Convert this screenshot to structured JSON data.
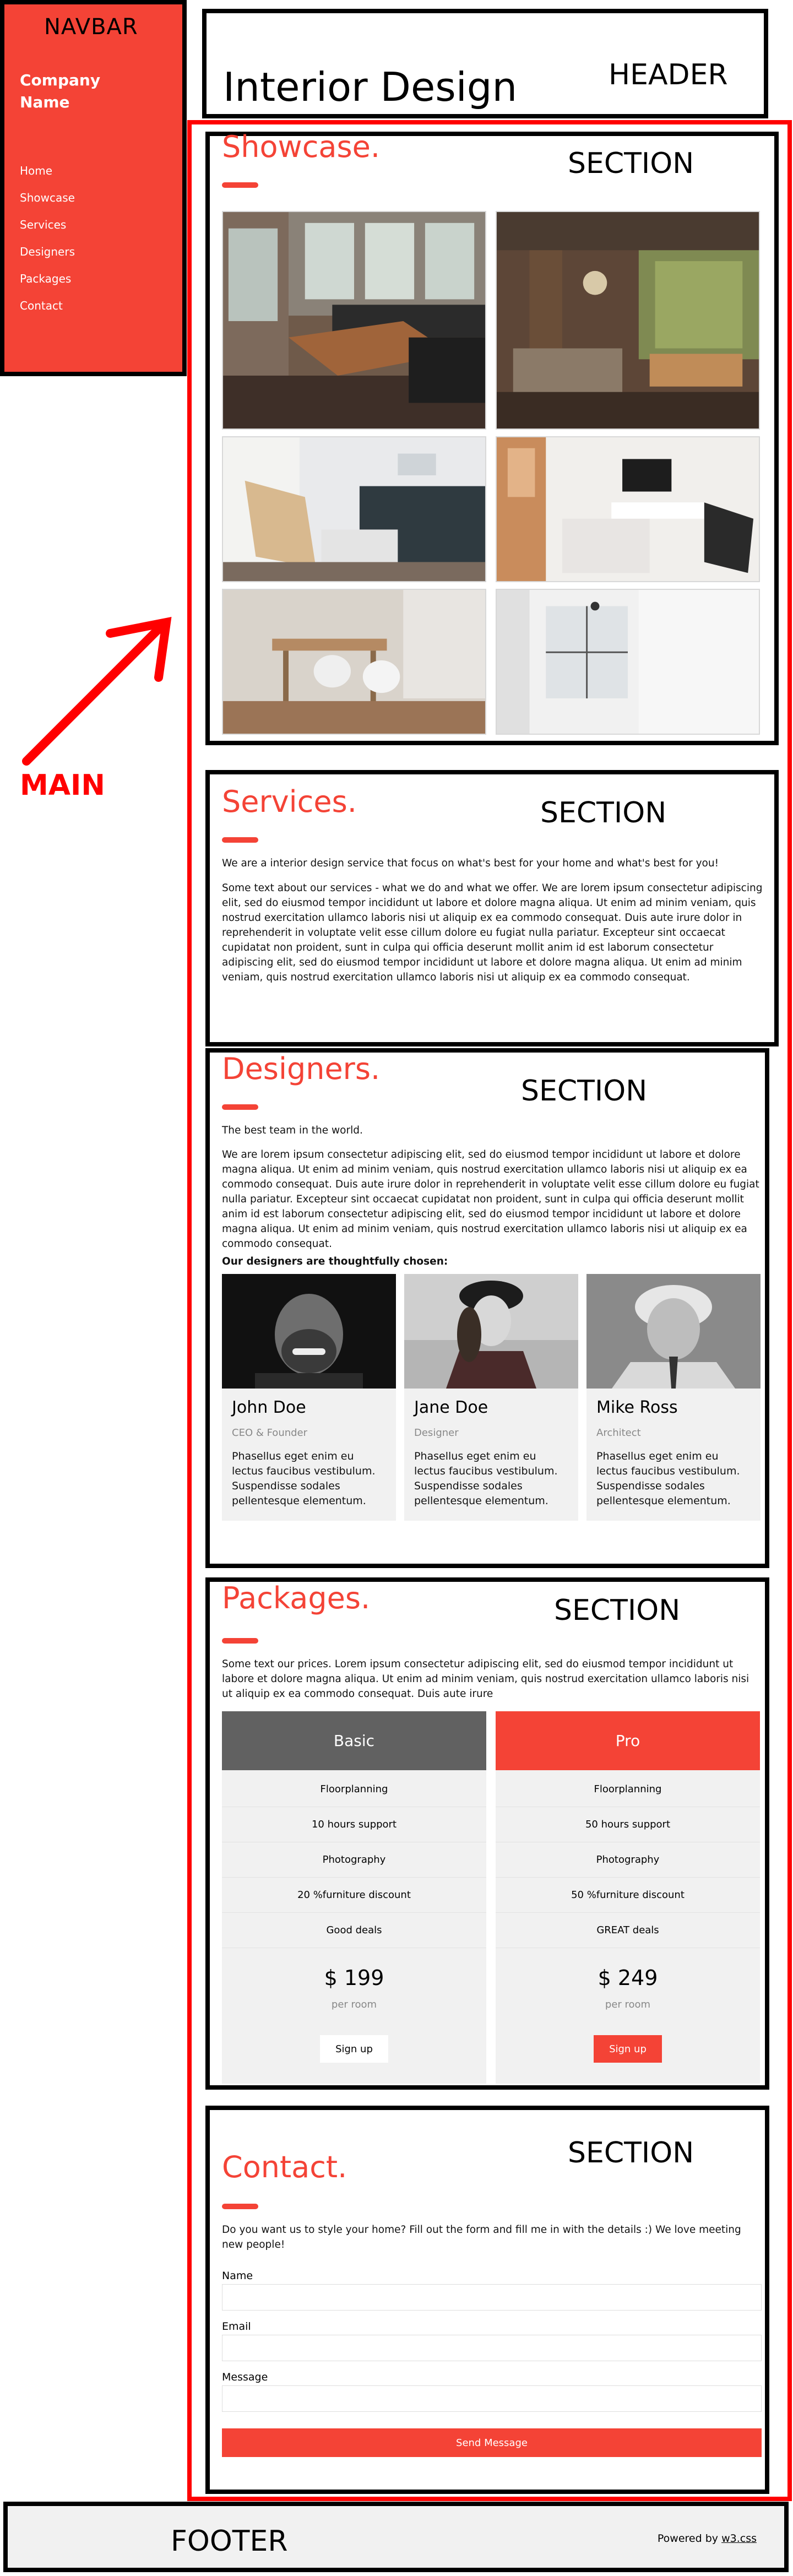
{
  "annotations": {
    "navbar": "NAVBAR",
    "header": "HEADER",
    "section": "SECTION",
    "main": "MAIN",
    "footer": "FOOTER"
  },
  "navbar": {
    "company": "Company Name",
    "items": [
      "Home",
      "Showcase",
      "Services",
      "Designers",
      "Packages",
      "Contact"
    ]
  },
  "header": {
    "title": "Interior Design"
  },
  "showcase": {
    "title": "Showcase.",
    "photos": [
      "kitchen-loft-photo",
      "living-room-photo",
      "bedroom-chair-photo",
      "bedroom-tv-photo",
      "dining-room-photo",
      "bright-room-photo"
    ]
  },
  "services": {
    "title": "Services.",
    "intro": "We are a interior design service that focus on what's best for your home and what's best for you!",
    "body": "Some text about our services - what we do and what we offer. We are lorem ipsum consectetur adipiscing elit, sed do eiusmod tempor incididunt ut labore et dolore magna aliqua. Ut enim ad minim veniam, quis nostrud exercitation ullamco laboris nisi ut aliquip ex ea commodo consequat. Duis aute irure dolor in reprehenderit in voluptate velit esse cillum dolore eu fugiat nulla pariatur. Excepteur sint occaecat cupidatat non proident, sunt in culpa qui officia deserunt mollit anim id est laborum consectetur adipiscing elit, sed do eiusmod tempor incididunt ut labore et dolore magna aliqua. Ut enim ad minim veniam, quis nostrud exercitation ullamco laboris nisi ut aliquip ex ea commodo consequat."
  },
  "designers": {
    "title": "Designers.",
    "intro": "The best team in the world.",
    "body": "We are lorem ipsum consectetur adipiscing elit, sed do eiusmod tempor incididunt ut labore et dolore magna aliqua. Ut enim ad minim veniam, quis nostrud exercitation ullamco laboris nisi ut aliquip ex ea commodo consequat. Duis aute irure dolor in reprehenderit in voluptate velit esse cillum dolore eu fugiat nulla pariatur. Excepteur sint occaecat cupidatat non proident, sunt in culpa qui officia deserunt mollit anim id est laborum consectetur adipiscing elit, sed do eiusmod tempor incididunt ut labore et dolore magna aliqua. Ut enim ad minim veniam, quis nostrud exercitation ullamco laboris nisi ut aliquip ex ea commodo consequat.",
    "chosen": "Our designers are thoughtfully chosen:",
    "people": [
      {
        "name": "John Doe",
        "role": "CEO & Founder",
        "desc": "Phasellus eget enim eu lectus faucibus vestibulum. Suspendisse sodales pellentesque elementum."
      },
      {
        "name": "Jane Doe",
        "role": "Designer",
        "desc": "Phasellus eget enim eu lectus faucibus vestibulum. Suspendisse sodales pellentesque elementum."
      },
      {
        "name": "Mike Ross",
        "role": "Architect",
        "desc": "Phasellus eget enim eu lectus faucibus vestibulum. Suspendisse sodales pellentesque elementum."
      }
    ]
  },
  "packages": {
    "title": "Packages.",
    "intro": "Some text our prices. Lorem ipsum consectetur adipiscing elit, sed do eiusmod tempor incididunt ut labore et dolore magna aliqua. Ut enim ad minim veniam, quis nostrud exercitation ullamco laboris nisi ut aliquip ex ea commodo consequat. Duis aute irure",
    "plans": [
      {
        "name": "Basic",
        "features": [
          "Floorplanning",
          "10 hours support",
          "Photography",
          "20 %furniture discount",
          "Good deals"
        ],
        "price": "$ 199",
        "per": "per room",
        "button": "Sign up",
        "color": "#616161"
      },
      {
        "name": "Pro",
        "features": [
          "Floorplanning",
          "50 hours support",
          "Photography",
          "50 %furniture discount",
          "GREAT deals"
        ],
        "price": "$ 249",
        "per": "per room",
        "button": "Sign up",
        "color": "#f44336"
      }
    ]
  },
  "contact": {
    "title": "Contact.",
    "intro": "Do you want us to style your home? Fill out the form and fill me in with the details :) We love meeting new people!",
    "fields": [
      {
        "label": "Name",
        "value": ""
      },
      {
        "label": "Email",
        "value": ""
      },
      {
        "label": "Message",
        "value": ""
      }
    ],
    "submit": "Send Message"
  },
  "footer": {
    "powered": "Powered by",
    "link": "w3.css"
  },
  "colors": {
    "accent": "#f44336",
    "annotation_main": "#ff0000",
    "border": "#000000"
  }
}
